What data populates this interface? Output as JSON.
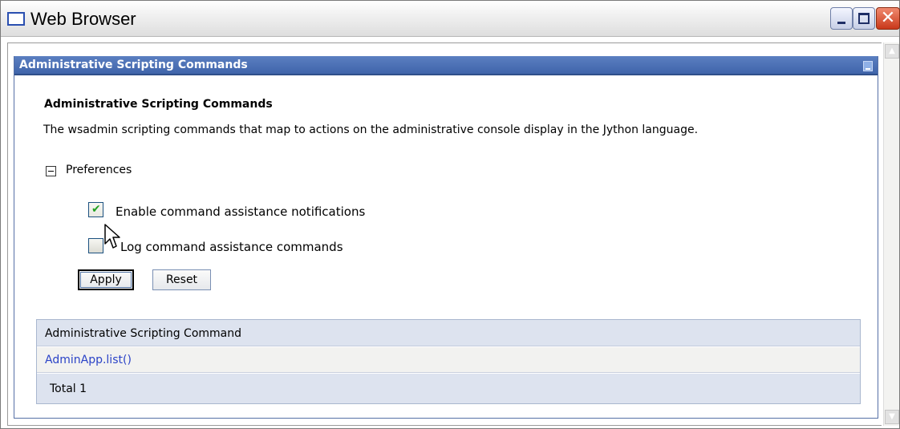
{
  "window": {
    "title": "Web Browser"
  },
  "portlet": {
    "header_title": "Administrative Scripting Commands"
  },
  "page": {
    "heading": "Administrative Scripting Commands",
    "description": "The wsadmin scripting commands that map to actions on the administrative console display in the Jython language."
  },
  "preferences": {
    "label": "Preferences",
    "expanded": true,
    "options": [
      {
        "label": "Enable command assistance notifications",
        "checked": true
      },
      {
        "label": "Log command assistance commands",
        "checked": false
      }
    ],
    "apply_label": "Apply",
    "reset_label": "Reset"
  },
  "table": {
    "header": "Administrative Scripting Command",
    "rows": [
      "AdminApp.list()"
    ],
    "total": "Total 1"
  },
  "colors": {
    "portlet_header": "#4a6fb5",
    "link": "#2b43c7",
    "table_header_bg": "#dde3ef",
    "check_green": "#21a121"
  }
}
